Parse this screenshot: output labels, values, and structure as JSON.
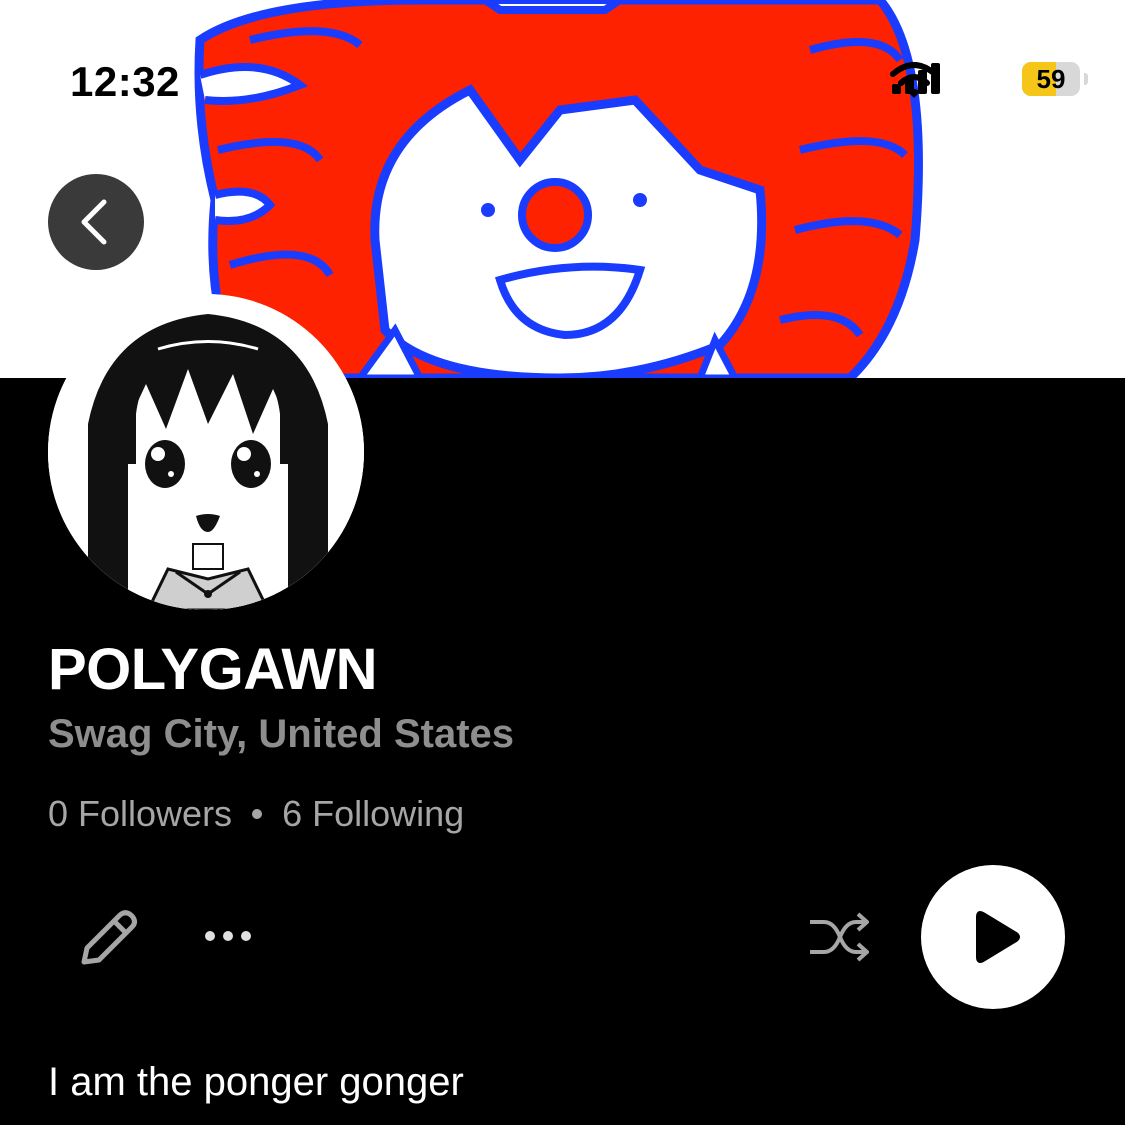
{
  "status_bar": {
    "time": "12:32",
    "battery_level": "59",
    "battery_fraction": 0.59,
    "icons": [
      "signal-icon",
      "wifi-icon",
      "battery-icon"
    ]
  },
  "banner": {
    "image": "clown-drawing-banner"
  },
  "navigation": {
    "back_icon": "chevron-left-icon"
  },
  "profile": {
    "avatar": "anime-girl-avatar",
    "name": "POLYGAWN",
    "location": "Swag City, United States",
    "followers": "0 Followers",
    "following": "6 Following",
    "bio": "I am the ponger gonger"
  },
  "actions": {
    "icons": [
      "pencil-icon",
      "more-horizontal-icon",
      "shuffle-icon",
      "play-icon"
    ]
  },
  "colors": {
    "background": "#000000",
    "secondary_text": "#8e8e8e",
    "stats_text": "#a6a6a6",
    "battery_accent": "#f5c518",
    "banner_red": "#ff2200",
    "banner_blue": "#1a3cff"
  }
}
